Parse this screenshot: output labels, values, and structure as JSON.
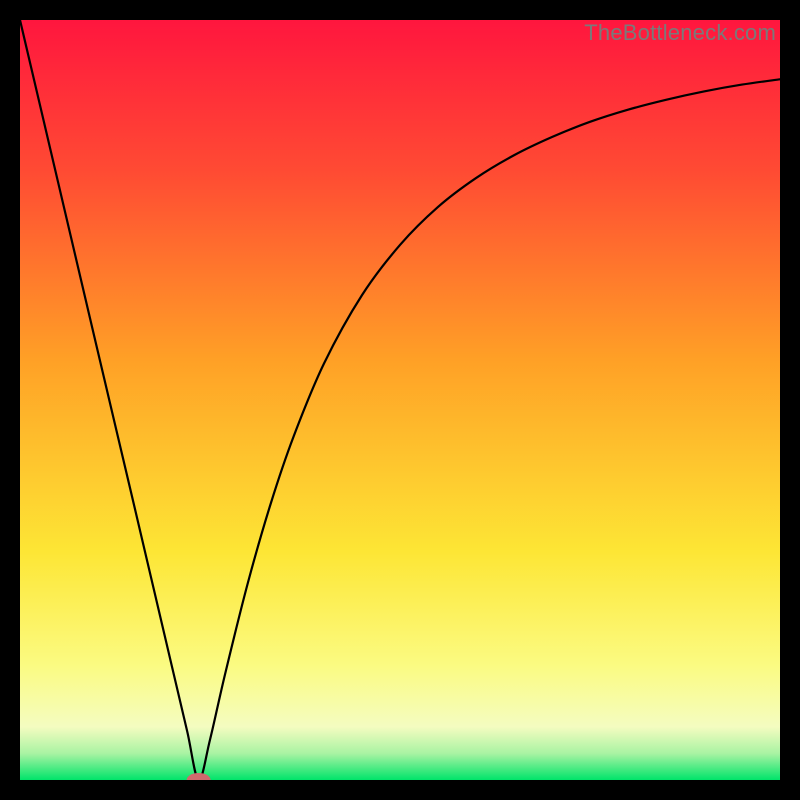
{
  "watermark": "TheBottleneck.com",
  "chart_data": {
    "type": "line",
    "title": "",
    "xlabel": "",
    "ylabel": "",
    "xlim": [
      0,
      100
    ],
    "ylim": [
      0,
      100
    ],
    "grid": false,
    "series": [
      {
        "name": "curve",
        "x": [
          0,
          5,
          10,
          15,
          20,
          22,
          23.5,
          25,
          27,
          30,
          33,
          36,
          40,
          45,
          50,
          55,
          60,
          65,
          70,
          75,
          80,
          85,
          90,
          95,
          100
        ],
        "y": [
          100,
          78.7,
          57.4,
          36.2,
          14.9,
          6.4,
          0,
          5.3,
          14.0,
          26.0,
          36.4,
          45.2,
          54.8,
          63.8,
          70.4,
          75.4,
          79.2,
          82.2,
          84.6,
          86.6,
          88.2,
          89.5,
          90.6,
          91.5,
          92.2
        ]
      }
    ],
    "marker": {
      "name": "min-marker",
      "x": 23.5,
      "y": 0,
      "color": "#cf6a6d"
    },
    "gradient_stops": [
      {
        "pos": 0.0,
        "color": "#ff163e"
      },
      {
        "pos": 0.2,
        "color": "#ff4b33"
      },
      {
        "pos": 0.45,
        "color": "#ffa126"
      },
      {
        "pos": 0.7,
        "color": "#fde635"
      },
      {
        "pos": 0.85,
        "color": "#fbfb82"
      },
      {
        "pos": 0.93,
        "color": "#f4fcc0"
      },
      {
        "pos": 0.965,
        "color": "#a9f3a3"
      },
      {
        "pos": 1.0,
        "color": "#00e46a"
      }
    ]
  }
}
